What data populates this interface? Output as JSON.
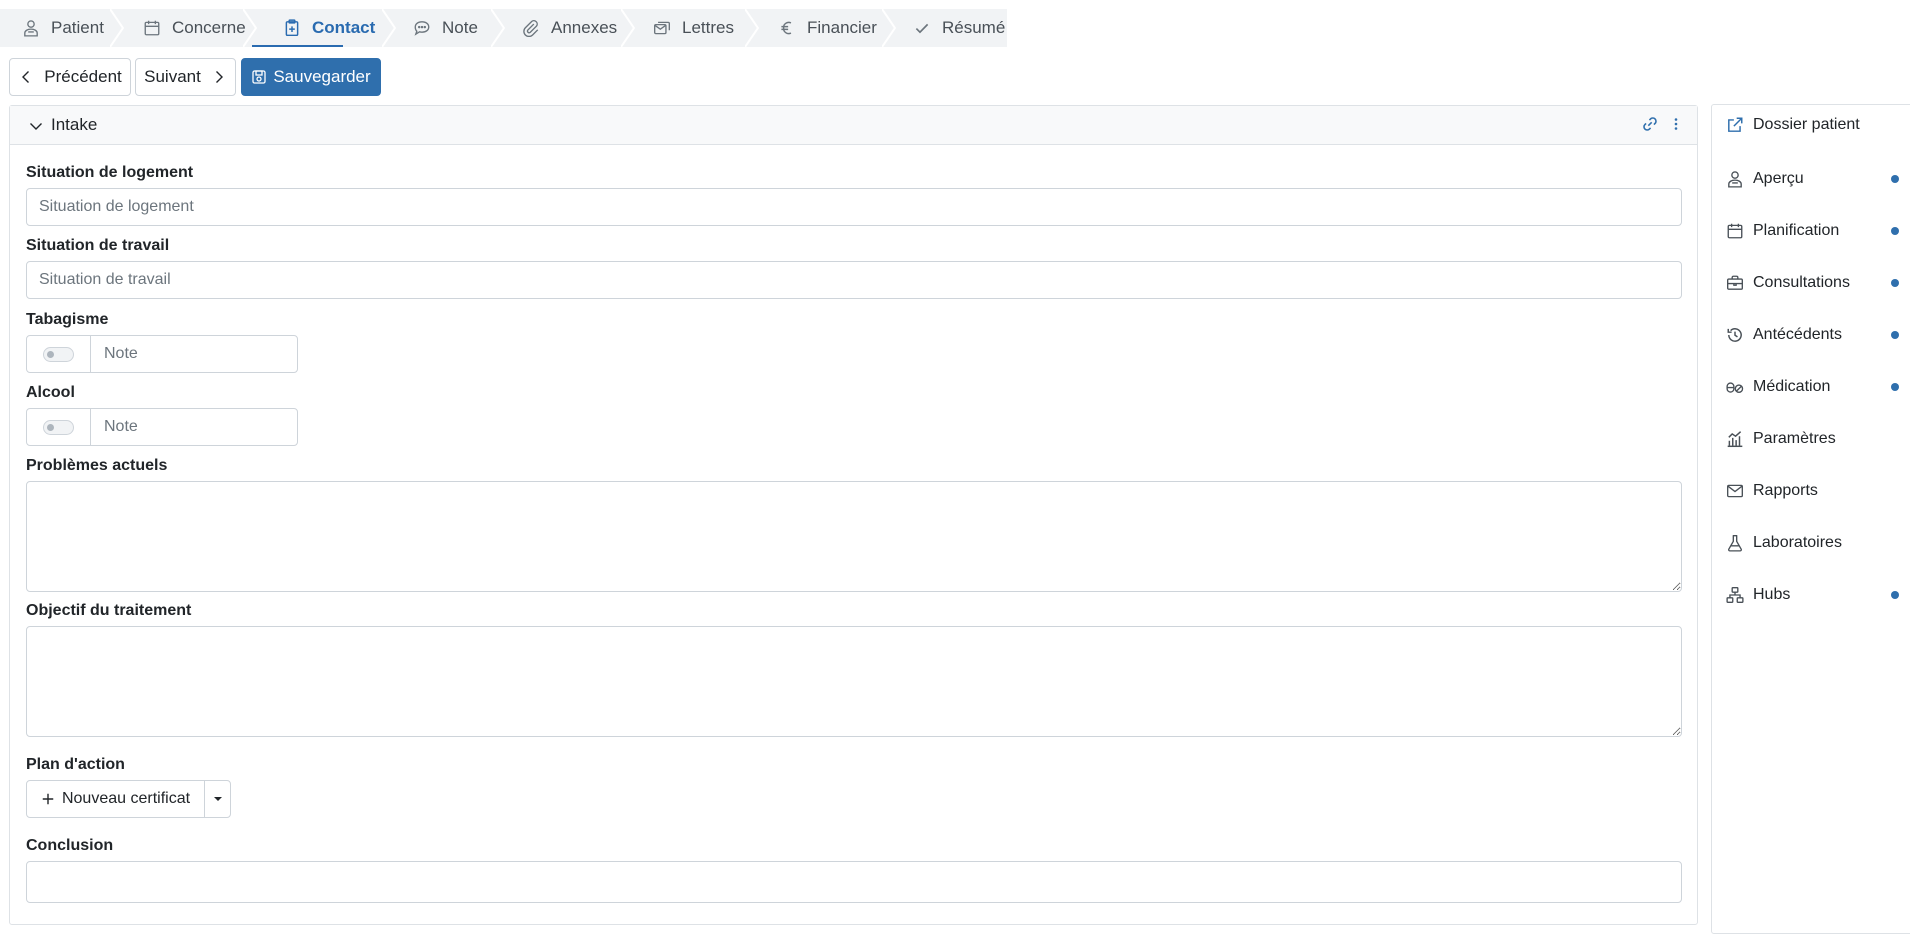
{
  "tabs": [
    {
      "label": "Patient",
      "icon": "patient-icon"
    },
    {
      "label": "Concerne",
      "icon": "calendar-icon"
    },
    {
      "label": "Contact",
      "icon": "clipboard-plus-icon",
      "active": true
    },
    {
      "label": "Note",
      "icon": "chat-icon"
    },
    {
      "label": "Annexes",
      "icon": "paperclip-icon"
    },
    {
      "label": "Lettres",
      "icon": "envelopes-icon"
    },
    {
      "label": "Financier",
      "icon": "euro-icon"
    },
    {
      "label": "Résumé",
      "icon": "check-icon"
    }
  ],
  "toolbar": {
    "previous_label": "Précédent",
    "next_label": "Suivant",
    "save_label": "Sauvegarder"
  },
  "panel": {
    "title": "Intake"
  },
  "form": {
    "housing_label": "Situation de logement",
    "housing_placeholder": "Situation de logement",
    "work_label": "Situation de travail",
    "work_placeholder": "Situation de travail",
    "smoking_label": "Tabagisme",
    "smoking_note_placeholder": "Note",
    "alcohol_label": "Alcool",
    "alcohol_note_placeholder": "Note",
    "problems_label": "Problèmes actuels",
    "objective_label": "Objectif du traitement",
    "action_plan_label": "Plan d'action",
    "new_certificate_label": "Nouveau certificat",
    "conclusion_label": "Conclusion"
  },
  "sidebar": {
    "items": [
      {
        "label": "Dossier patient",
        "icon": "external-link-icon",
        "dot": false
      },
      {
        "label": "Aperçu",
        "icon": "patient-icon",
        "dot": true
      },
      {
        "label": "Planification",
        "icon": "calendar-icon",
        "dot": true
      },
      {
        "label": "Consultations",
        "icon": "briefcase-icon",
        "dot": true
      },
      {
        "label": "Antécédents",
        "icon": "history-icon",
        "dot": true
      },
      {
        "label": "Médication",
        "icon": "pills-icon",
        "dot": true
      },
      {
        "label": "Paramètres",
        "icon": "chart-icon",
        "dot": false
      },
      {
        "label": "Rapports",
        "icon": "envelope-icon",
        "dot": false
      },
      {
        "label": "Laboratoires",
        "icon": "flask-icon",
        "dot": false
      },
      {
        "label": "Hubs",
        "icon": "hierarchy-icon",
        "dot": true
      }
    ]
  },
  "colors": {
    "accent": "#2f6fad",
    "active_tab": "#2a6bb0",
    "border": "#ced4da",
    "tab_bg": "#f1f3f5"
  }
}
